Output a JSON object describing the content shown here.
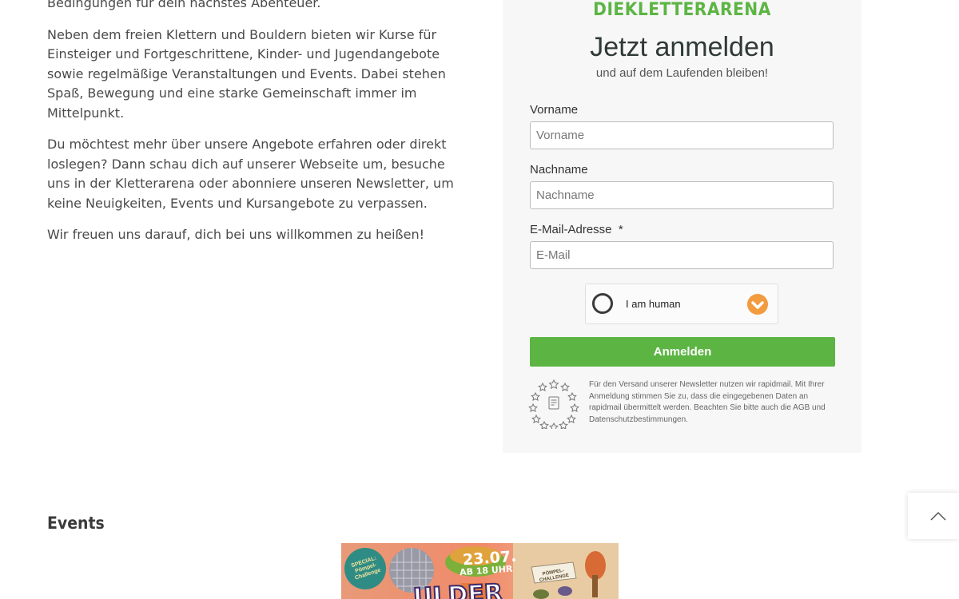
{
  "intro": {
    "paragraphs": [
      "Bedingungen für dein nächstes Abenteuer.",
      "Neben dem freien Klettern und Bouldern bieten wir Kurse für Einsteiger und Fortgeschrittene, Kinder- und Jugendangebote sowie regelmäßige Veranstaltungen und Events. Dabei stehen Spaß, Bewegung und eine starke Gemeinschaft immer im Mittelpunkt.",
      "Du möchtest mehr über unsere Angebote erfahren oder direkt loslegen? Dann schau dich auf unserer Webseite um, besuche uns in der Kletterarena oder abonniere unseren Newsletter, um keine Neuigkeiten, Events und Kursangebote zu verpassen.",
      "Wir freuen uns darauf, dich bei uns willkommen zu heißen!"
    ]
  },
  "newsletter": {
    "brand": "DIEKLETTERARENA",
    "title": "Jetzt anmelden",
    "subtitle": "und auf dem Laufenden bleiben!",
    "fields": [
      {
        "label": "Vorname",
        "placeholder": "Vorname",
        "value": ""
      },
      {
        "label": "Nachname",
        "placeholder": "Nachname",
        "value": ""
      },
      {
        "label": "E-Mail-Adresse",
        "required_mark": "*",
        "placeholder": "E-Mail",
        "value": ""
      }
    ],
    "captcha": {
      "label": "I am human",
      "logo_icon": "hcaptcha-logo-icon"
    },
    "submit_label": "Anmelden",
    "badge_icon": "gdpr-stars-badge-icon",
    "disclaimer": "Für den Versand unserer Newsletter nutzen wir rapidmail. Mit Ihrer Anmeldung stimmen Sie zu, dass die eingegebenen Daten an rapidmail übermittelt werden. Beachten Sie bitte auch die AGB und Datenschutzbestimmungen."
  },
  "events": {
    "heading": "Events",
    "poster": {
      "badge_text": "SPECIAL: Pömpel-Challenge",
      "date": "23.07.",
      "time": "AB 18 UHR",
      "title_partial": "ULDER",
      "sticker": "PÖMPEL-CHALLENGE"
    }
  },
  "scroll_top_icon": "chevron-up-icon",
  "colors": {
    "brand_green": "#5cb543",
    "card_bg": "#f7f7f7",
    "text": "#4a4a4a",
    "captcha_orange": "#f39b3f"
  }
}
